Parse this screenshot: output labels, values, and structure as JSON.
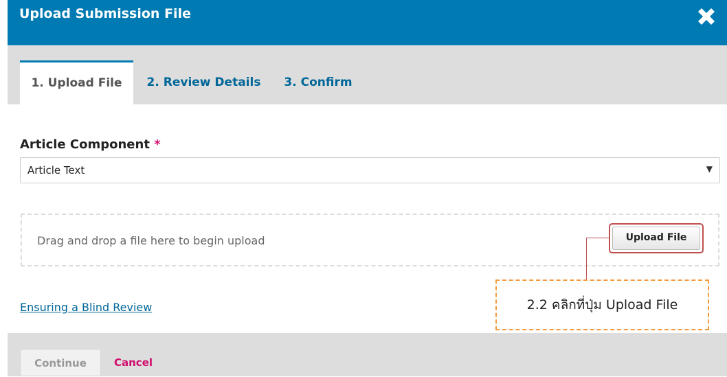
{
  "dialog": {
    "title": "Upload Submission File",
    "close_icon": "close-x-icon"
  },
  "tabs": [
    {
      "label": "1. Upload File",
      "active": true
    },
    {
      "label": "2. Review Details",
      "active": false
    },
    {
      "label": "3. Confirm",
      "active": false
    }
  ],
  "form": {
    "component_label": "Article Component",
    "required_marker": "*",
    "component_value": "Article Text",
    "dropdown_arrow": "▼"
  },
  "dropzone": {
    "text": "Drag and drop a file here to begin upload",
    "upload_button": "Upload File"
  },
  "annotation": {
    "text": "2.2 คลิกที่ปุ่ม Upload File"
  },
  "links": {
    "blind_review": "Ensuring a Blind Review"
  },
  "footer": {
    "continue_label": "Continue",
    "cancel_label": "Cancel"
  },
  "colors": {
    "header": "#007ab2",
    "link": "#006798",
    "cancel": "#d00a6c",
    "annotation_box": "#f39a3c",
    "annotation_leader": "#c0504d"
  }
}
